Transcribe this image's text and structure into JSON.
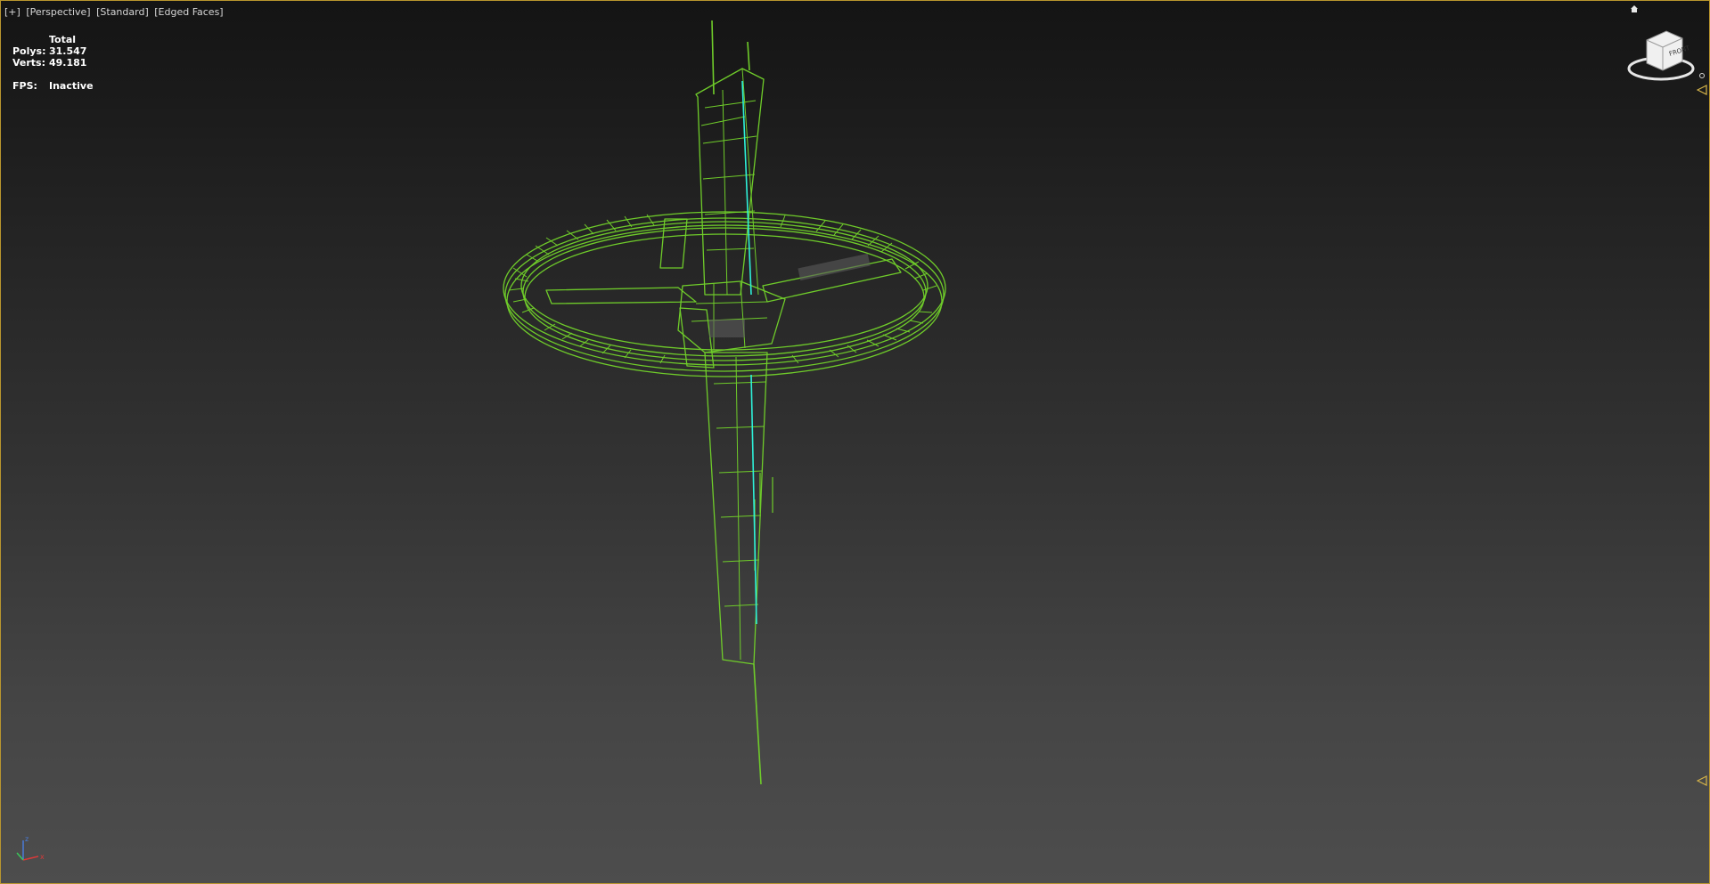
{
  "viewport": {
    "labels": [
      "[+]",
      "[Perspective]",
      "[Standard]",
      "[Edged Faces]"
    ],
    "stats": {
      "header": "Total",
      "polys_label": "Polys:",
      "polys_value": "31.547",
      "verts_label": "Verts:",
      "verts_value": "49.181",
      "fps_label": "FPS:",
      "fps_value": "Inactive"
    },
    "navcube_face": "FRONT",
    "axis_labels": {
      "z": "z",
      "x": "x",
      "y": "y"
    }
  },
  "colors": {
    "wire": "#6fcc2a",
    "wire_highlight": "#2ef0d8",
    "frame_border": "#b9962e",
    "text": "#d6d6d6"
  },
  "icons": {
    "home": "home-icon",
    "navcube": "viewcube-icon",
    "tripod": "axis-tripod-icon"
  }
}
